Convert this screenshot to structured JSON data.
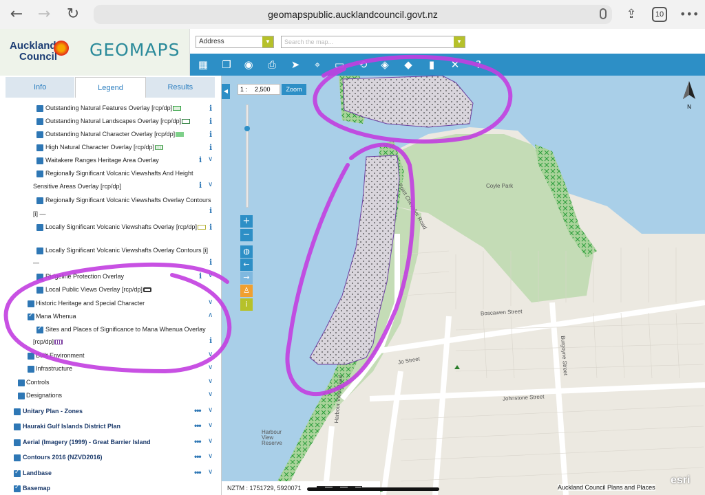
{
  "browser": {
    "url": "geomapspublic.aucklandcouncil.govt.nz",
    "tabs_count": "10"
  },
  "header": {
    "logo_line1": "Auckland",
    "logo_line2": "Council",
    "app_name": "GEOMAPS",
    "address_select": "Address",
    "search_placeholder": "Search the map..."
  },
  "panel": {
    "tabs": [
      {
        "label": "Info"
      },
      {
        "label": "Legend"
      },
      {
        "label": "Results"
      }
    ],
    "layers": [
      {
        "label": "Outstanding Natural Features Overlay [rcp/dp]"
      },
      {
        "label": "Outstanding Natural Landscapes Overlay [rcp/dp]"
      },
      {
        "label": "Outstanding Natural Character Overlay [rcp/dp]"
      },
      {
        "label": "High Natural Character Overlay [rcp/dp]"
      },
      {
        "label": "Waitakere Ranges Heritage Area Overlay"
      },
      {
        "label": "Regionally Significant Volcanic Viewshafts And Height"
      },
      {
        "label": "Sensitive Areas Overlay [rcp/dp]"
      },
      {
        "label": "Regionally Significant Volcanic Viewshafts Overlay Contours"
      },
      {
        "label": "[i] —"
      },
      {
        "label": "Locally Significant Volcanic Viewshafts Overlay [rcp/dp]"
      },
      {
        "label": "Locally Significant Volcanic Viewshafts Overlay Contours [i]"
      },
      {
        "label": "—"
      },
      {
        "label": "Ridgeline Protection Overlay"
      },
      {
        "label": "Local Public Views Overlay [rcp/dp]"
      },
      {
        "label": "Historic Heritage and Special Character"
      },
      {
        "label": "Mana Whenua"
      },
      {
        "label": "Sites and Places of Significance to Mana Whenua Overlay"
      },
      {
        "label": "[rcp/dp]"
      },
      {
        "label": "Built Environment"
      },
      {
        "label": "Infrastructure"
      },
      {
        "label": "Controls"
      },
      {
        "label": "Designations"
      }
    ],
    "groups": [
      {
        "label": "Unitary Plan - Zones"
      },
      {
        "label": "Hauraki Gulf Islands District Plan"
      },
      {
        "label": "Aerial (Imagery (1999) - Great Barrier Island"
      },
      {
        "label": "Contours 2016 (NZVD2016)"
      },
      {
        "label": "Landbase"
      },
      {
        "label": "Basemap"
      }
    ]
  },
  "map": {
    "scale_prefix": "1 :",
    "scale_value": "2,500",
    "zoom_label": "Zoom",
    "north_label": "N",
    "labels": {
      "coyle_park": "Coyle Park",
      "point_chevalier_road": "Point Chevalier Road",
      "boscawen_street": "Boscawen Street",
      "burgoyne_street": "Burgoyne Street",
      "johnstone_street": "Johnstone Street",
      "harbour_view_road": "Harbour View Road",
      "jo_street": "Jo Street",
      "harbour_view_reserve": "Harbour View Reserve"
    },
    "coords": "NZTM : 1751729, 5920071",
    "attribution": "Auckland Council Plans and Places",
    "esri": "esri",
    "colors": {
      "water": "#a9cfe8",
      "park": "#c4dcb6",
      "land": "#ece9e1",
      "annotation": "#c23ee0",
      "toolbar": "#2d8fc6"
    }
  }
}
